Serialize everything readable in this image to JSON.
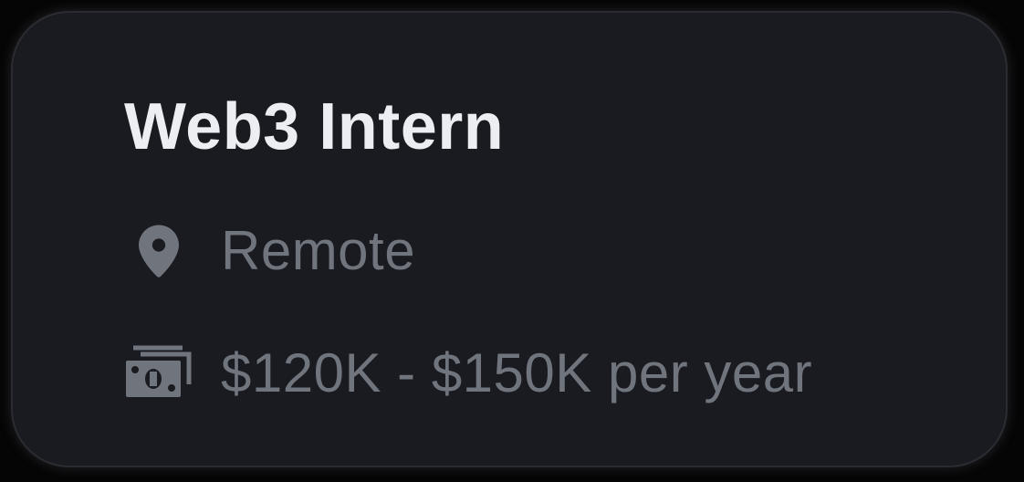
{
  "job": {
    "title": "Web3 Intern",
    "location": "Remote",
    "salary": "$120K - $150K per year"
  },
  "icons": {
    "location": "map-pin-icon",
    "salary": "cash-icon"
  },
  "colors": {
    "background": "#050506",
    "card": "#1a1b20",
    "title": "#eceef2",
    "muted": "#70747c"
  }
}
